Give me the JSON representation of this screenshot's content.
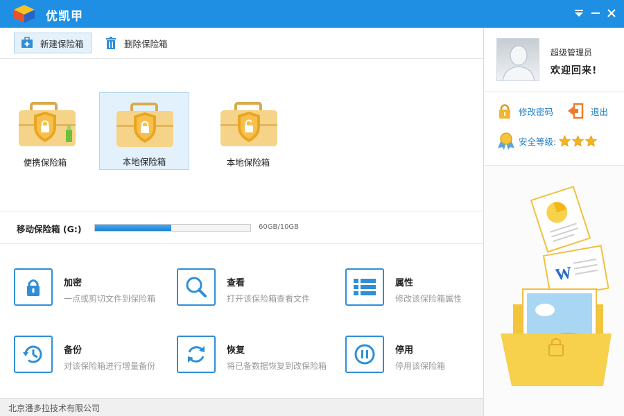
{
  "app": {
    "title": "优凯甲"
  },
  "window_controls": {
    "icons": [
      "dropdown-icon",
      "minimize-icon",
      "close-icon"
    ]
  },
  "toolbar": {
    "new_vault_label": "新建保险箱",
    "delete_vault_label": "删除保险箱"
  },
  "vaults": [
    {
      "label": "便携保险箱",
      "type": "portable",
      "selected": false,
      "locked": true
    },
    {
      "label": "本地保险箱",
      "type": "local",
      "selected": true,
      "locked": true
    },
    {
      "label": "本地保险箱",
      "type": "local",
      "selected": false,
      "locked": false
    }
  ],
  "storage": {
    "label": "移动保险箱 (G:)",
    "used_text": "60GB/10GB",
    "fill_percent": 49
  },
  "actions": [
    {
      "title": "加密",
      "desc": "一点或剪切文件到保险箱",
      "icon": "lock-icon"
    },
    {
      "title": "查看",
      "desc": "打开该保险箱查看文件",
      "icon": "search-icon"
    },
    {
      "title": "属性",
      "desc": "修改该保险箱属性",
      "icon": "list-icon"
    },
    {
      "title": "备份",
      "desc": "对该保险箱进行增量备份",
      "icon": "backup-clock-icon"
    },
    {
      "title": "恢复",
      "desc": "将已备数据恢复到改保险箱",
      "icon": "refresh-icon"
    },
    {
      "title": "停用",
      "desc": "停用该保险箱",
      "icon": "pause-icon"
    }
  ],
  "status_bar": {
    "text": "北京潘多拉技术有限公司"
  },
  "user": {
    "name": "超级管理员",
    "welcome": "欢迎回来!",
    "change_password_label": "修改密码",
    "logout_label": "退出",
    "security_level_label": "安全等级:",
    "security_stars": 3
  },
  "colors": {
    "titlebar": "#1f8fe3",
    "accent": "#2f8ed6",
    "vault_body": "#f5d489",
    "vault_shield": "#e9a623",
    "link": "#1d7ec8"
  }
}
